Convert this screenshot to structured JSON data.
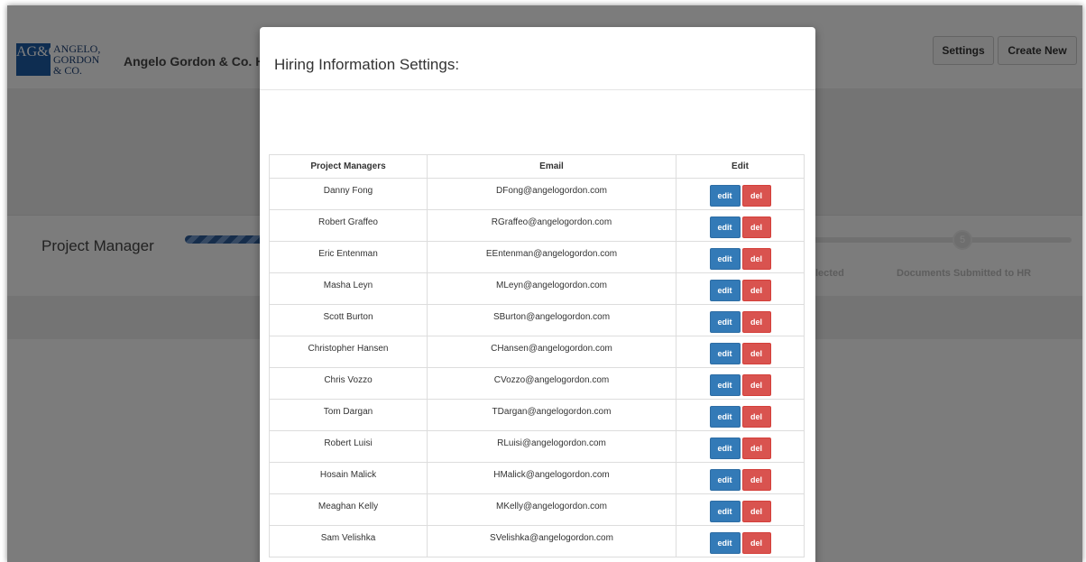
{
  "app": {
    "logo_mark": "AG&Co",
    "logo_words": [
      "ANGELO,",
      "GORDON",
      "& CO."
    ],
    "title": "Angelo Gordon & Co. H",
    "settings_label": "Settings",
    "create_new_label": "Create New",
    "section_label": "Project Manager",
    "step_dot": "5",
    "step_labels": [
      "lected",
      "Documents Submitted to HR"
    ]
  },
  "modal": {
    "title": "Hiring Information Settings:",
    "columns": [
      "Project Managers",
      "Email",
      "Edit"
    ],
    "edit_label": "edit",
    "del_label": "del",
    "rows": [
      {
        "name": "Danny Fong",
        "email": "DFong@angelogordon.com"
      },
      {
        "name": "Robert Graffeo",
        "email": "RGraffeo@angelogordon.com"
      },
      {
        "name": "Eric Entenman",
        "email": "EEntenman@angelogordon.com"
      },
      {
        "name": "Masha Leyn",
        "email": "MLeyn@angelogordon.com"
      },
      {
        "name": "Scott Burton",
        "email": "SBurton@angelogordon.com"
      },
      {
        "name": "Christopher Hansen",
        "email": "CHansen@angelogordon.com"
      },
      {
        "name": "Chris Vozzo",
        "email": "CVozzo@angelogordon.com"
      },
      {
        "name": "Tom Dargan",
        "email": "TDargan@angelogordon.com"
      },
      {
        "name": "Robert Luisi",
        "email": "RLuisi@angelogordon.com"
      },
      {
        "name": "Hosain Malick",
        "email": "HMalick@angelogordon.com"
      },
      {
        "name": "Meaghan Kelly",
        "email": "MKelly@angelogordon.com"
      },
      {
        "name": "Sam Velishka",
        "email": "SVelishka@angelogordon.com"
      }
    ]
  },
  "colors": {
    "edit_button": "#337ab7",
    "del_button": "#d9534f",
    "brand": "#1d5aa3"
  }
}
